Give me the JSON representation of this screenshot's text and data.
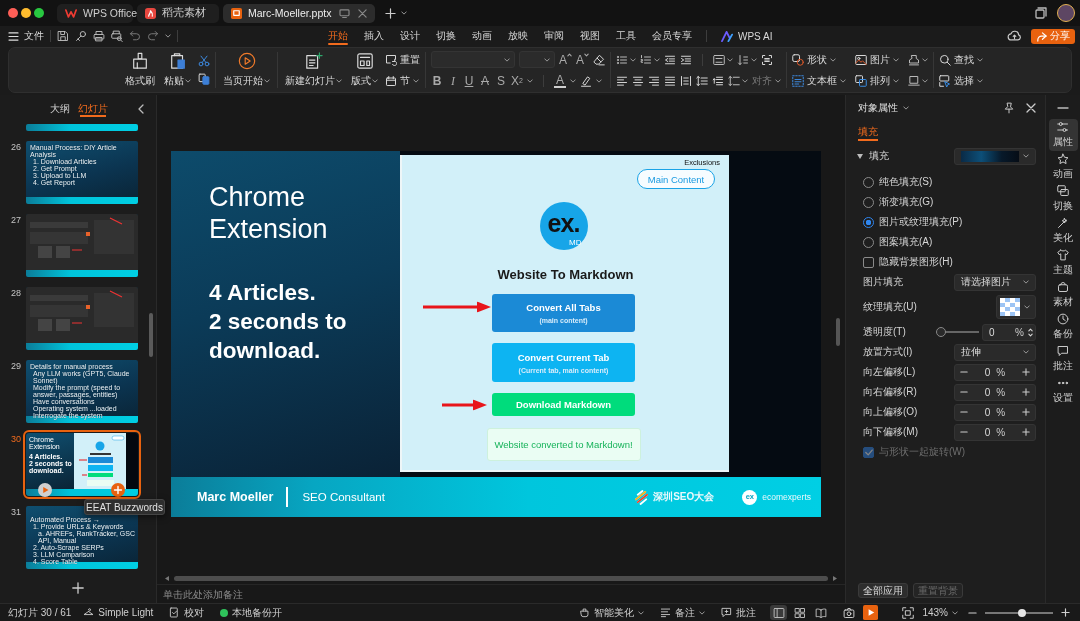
{
  "window": {
    "tabs": [
      {
        "label": "WPS Office",
        "selected": false
      },
      {
        "label": "稻壳素材",
        "selected": false
      },
      {
        "label": "Marc-Moeller.pptx",
        "selected": true
      }
    ]
  },
  "menu": {
    "file": "文件",
    "tabs": [
      {
        "label": "开始",
        "selected": true
      },
      {
        "label": "插入",
        "selected": false
      },
      {
        "label": "设计",
        "selected": false
      },
      {
        "label": "切换",
        "selected": false
      },
      {
        "label": "动画",
        "selected": false
      },
      {
        "label": "放映",
        "selected": false
      },
      {
        "label": "审阅",
        "selected": false
      },
      {
        "label": "视图",
        "selected": false
      },
      {
        "label": "工具",
        "selected": false
      },
      {
        "label": "会员专享",
        "selected": false
      },
      {
        "label": "WPS AI",
        "selected": false
      }
    ],
    "share": "分享"
  },
  "ribbon": {
    "format_painter": "格式刷",
    "paste": "粘贴",
    "play_from_current": "当页开始",
    "new_slide": "新建幻灯片",
    "layout": "版式",
    "reset": "重置",
    "section": "节",
    "font_size_buttons": [
      "A",
      "A"
    ],
    "text_styles": [
      "B",
      "I",
      "U",
      "A",
      "S",
      "X$^{2}$"
    ],
    "font_color": "A",
    "align": {
      "label": "对齐",
      "disabled": true
    },
    "shape": "形状",
    "picture": "图片",
    "text_box": "文本框",
    "arrange": "排列",
    "find": "查找",
    "select": "选择"
  },
  "slides_panel": {
    "tabs": [
      {
        "label": "大纲",
        "selected": false
      },
      {
        "label": "幻灯片",
        "selected": true
      }
    ],
    "thumbnails": [
      {
        "kind": "partial",
        "selected": false
      },
      {
        "number": "26",
        "kind": "text",
        "selected": false,
        "title": "Manual Process: DIY Article Analysis",
        "lines": [
          {
            "text": "1. Download Articles"
          },
          {
            "text": "2. Get Prompt"
          },
          {
            "text": "3. Upload to LLM"
          },
          {
            "text": "4. Get Report"
          }
        ]
      },
      {
        "number": "27",
        "kind": "screenshot",
        "selected": false
      },
      {
        "number": "28",
        "kind": "screenshot",
        "selected": false
      },
      {
        "number": "29",
        "kind": "text",
        "selected": false,
        "title": "Details for manual process",
        "lines": [
          {
            "text": "Any LLM works (GPT5, Claude Sonnet)"
          },
          {
            "text": "Modify the prompt (speed to answer, passages, entities)"
          },
          {
            "text": "Have conversations"
          },
          {
            "text": "Operating system ...loaded"
          },
          {
            "text": "Interrogate the system"
          }
        ]
      },
      {
        "number": "30",
        "kind": "current",
        "selected": true,
        "title": "Chrome Extension",
        "lines": [
          {
            "text": "4 Articles."
          },
          {
            "text": "2 seconds to download."
          }
        ]
      },
      {
        "number": "31",
        "kind": "text",
        "selected": false,
        "title": "Automated Process →",
        "lines": [
          {
            "text": "1. Provide URLs & Keywords",
            "children": [
              {
                "text": "a. AHREFs, RankTracker, GSC API, Manual"
              }
            ]
          },
          {
            "text": "2. Auto-Scrape SERPs"
          },
          {
            "text": "3. LLM Comparison"
          },
          {
            "text": "4. Score Table"
          }
        ]
      }
    ],
    "tooltip": "EEAT Buzzwords"
  },
  "slide": {
    "title": "Chrome Extension",
    "body": [
      "4 Articles.",
      "2 seconds to download."
    ],
    "popup": {
      "exclusions": "Exclusions",
      "mode_button": "Main Content",
      "logo": {
        "text": "ex.",
        "badge": "MD"
      },
      "heading": "Website To Markdown",
      "buttons": [
        {
          "kind": "primary",
          "label": "Convert All Tabs",
          "sub": "(main content)",
          "arrow": true
        },
        {
          "kind": "secondary",
          "label": "Convert Current Tab",
          "sub": "(Current tab, main content)",
          "arrow": false
        },
        {
          "kind": "download",
          "label": "Download Markdown",
          "arrow": true
        }
      ],
      "message": "Website converted to Markdown!"
    },
    "footer": {
      "name": "Marc Moeller",
      "role": "SEO Consultant",
      "logos": [
        {
          "kind": "stripes",
          "text": "深圳SEO大会"
        },
        {
          "kind": "badge",
          "badge": "ex",
          "text": "ecomexperts"
        }
      ]
    }
  },
  "notes": {
    "placeholder": "单击此处添加备注"
  },
  "properties": {
    "title": "对象属性",
    "tabs": [
      {
        "label": "填充",
        "selected": true
      }
    ],
    "section": {
      "label": "填充",
      "expanded": true
    },
    "fill_options": [
      {
        "label": "纯色填充(S)",
        "selected": false
      },
      {
        "label": "渐变填充(G)",
        "selected": false
      },
      {
        "label": "图片或纹理填充(P)",
        "selected": true
      },
      {
        "label": "图案填充(A)",
        "selected": false
      }
    ],
    "hide_background": {
      "label": "隐藏背景图形(H)",
      "checked": false
    },
    "rows": [
      {
        "kind": "select",
        "label": "图片填充",
        "value": "请选择图片"
      },
      {
        "kind": "texture",
        "label": "纹理填充(U)"
      },
      {
        "kind": "slider",
        "label": "透明度(T)",
        "level": 0,
        "value": "0",
        "unit": "%"
      },
      {
        "kind": "select",
        "label": "放置方式(I)",
        "value": "拉伸"
      },
      {
        "kind": "stepper",
        "label": "向左偏移(L)",
        "value": "0",
        "unit": "%"
      },
      {
        "kind": "stepper",
        "label": "向右偏移(R)",
        "value": "0",
        "unit": "%"
      },
      {
        "kind": "stepper",
        "label": "向上偏移(O)",
        "value": "0",
        "unit": "%"
      },
      {
        "kind": "stepper",
        "label": "向下偏移(M)",
        "value": "0",
        "unit": "%"
      }
    ],
    "rotate_with_shape": {
      "label": "与形状一起旋转(W)",
      "checked": true,
      "disabled": true
    },
    "buttons": [
      {
        "label": "全部应用",
        "disabled": false
      },
      {
        "label": "重置背景",
        "disabled": true
      }
    ]
  },
  "side_tabs": [
    {
      "label": "属性",
      "selected": true
    },
    {
      "label": "动画",
      "selected": false
    },
    {
      "label": "切换",
      "selected": false
    },
    {
      "label": "美化",
      "selected": false
    },
    {
      "label": "主题",
      "selected": false
    },
    {
      "label": "素材",
      "selected": false
    },
    {
      "label": "备份",
      "selected": false
    },
    {
      "label": "批注",
      "selected": false
    },
    {
      "label": "设置",
      "selected": false
    }
  ],
  "status_bar": {
    "slide_counter": "幻灯片 30 / 61",
    "theme": "Simple Light",
    "proofing": "校对",
    "backup": "本地备份开",
    "beautify": "智能美化",
    "notes": "备注",
    "comments": "批注",
    "views": [
      {
        "selected": true
      },
      {
        "selected": false
      },
      {
        "selected": false
      }
    ],
    "zoom": "143%",
    "zoom_slider": {
      "level": 0.54
    }
  }
}
